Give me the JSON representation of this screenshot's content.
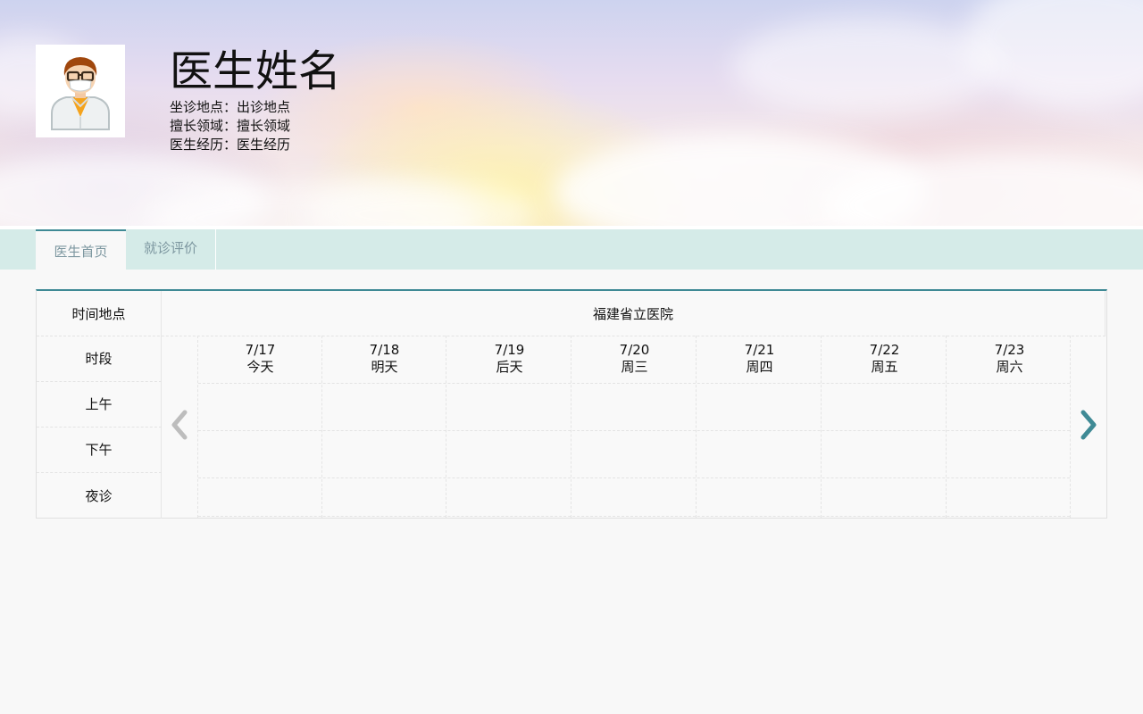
{
  "profile": {
    "name": "医生姓名",
    "details": [
      {
        "label": "坐诊地点：",
        "value": "出诊地点"
      },
      {
        "label": "擅长领域：",
        "value": "擅长领域"
      },
      {
        "label": "医生经历：",
        "value": "医生经历"
      }
    ]
  },
  "tabs": [
    {
      "label": "医生首页",
      "active": true
    },
    {
      "label": "就诊评价",
      "active": false
    }
  ],
  "schedule": {
    "header_label": "时间地点",
    "hospital": "福建省立医院",
    "period_label": "时段",
    "periods": [
      "上午",
      "下午",
      "夜诊"
    ],
    "days": [
      {
        "date": "7/17",
        "weekday": "今天"
      },
      {
        "date": "7/18",
        "weekday": "明天"
      },
      {
        "date": "7/19",
        "weekday": "后天"
      },
      {
        "date": "7/20",
        "weekday": "周三"
      },
      {
        "date": "7/21",
        "weekday": "周四"
      },
      {
        "date": "7/22",
        "weekday": "周五"
      },
      {
        "date": "7/23",
        "weekday": "周六"
      }
    ]
  },
  "icons": {
    "prev": "chevron-left-icon",
    "next": "chevron-right-icon",
    "avatar": "doctor-avatar-icon"
  },
  "colors": {
    "accent": "#3f8a95",
    "tabbar": "#d5ebe8",
    "arrow_disabled": "#bdbdbd"
  }
}
